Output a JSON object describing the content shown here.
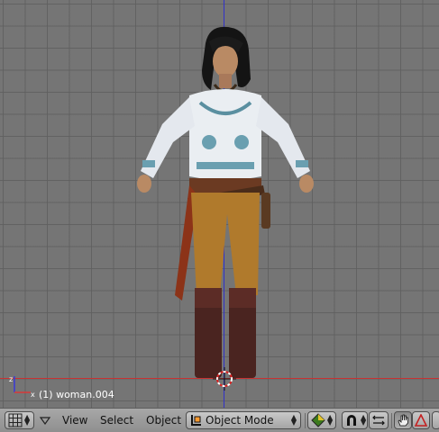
{
  "viewport": {
    "object_label": "(1) woman.004",
    "grid_color": "#5f5f5f",
    "background_color": "#757575",
    "x_axis_color": "#c83232",
    "z_axis_color": "#3232c8"
  },
  "header": {
    "menus": {
      "view": "View",
      "select": "Select",
      "object": "Object"
    },
    "mode": {
      "selected": "Object Mode"
    }
  },
  "icons": {
    "editor_type": "grid-icon",
    "collapse": "triangle-down-icon",
    "mode": "object-mode-icon",
    "draw_type": "solid-shading-icon",
    "manipulator": "magnet-icon",
    "transform": "translate-arrows-icon",
    "hand": "hand-icon",
    "rotate_widget": "triangle-icon"
  }
}
